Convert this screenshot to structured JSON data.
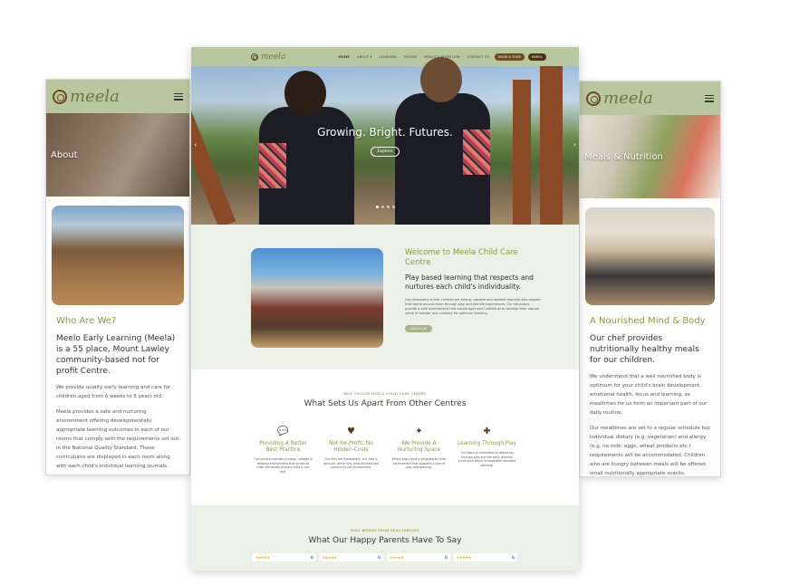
{
  "colors": {
    "header": "#b9c7a0",
    "accent_green": "#8a9a45",
    "brown": "#6b4a1e",
    "section_bg": "#edf0e6"
  },
  "brand": {
    "name": "meela"
  },
  "left_mobile": {
    "hero_title": "About",
    "heading": "Who Are We?",
    "lead": "Meelo Early Learning (Meela) is a 55 place, Mount Lawley community-based not for profit Centre.",
    "para1": "We provide quality early learning and care for children aged from 6 weeks to 5 years old.",
    "para2": "Meela provides a safe and nurturing environment offering developmentally appropriate learning outcomes in each of our rooms that comply with the requirements set out in the National Quality Standard. These curriculums are displayed in each room along with each child's individual learning journals."
  },
  "right_mobile": {
    "hero_title": "Meals & Nutrition",
    "heading": "A Nourished Mind & Body",
    "lead": "Our chef provides nutritionally healthy meals for our children.",
    "para1": "We understand that a well nourished body is optimum for your child's brain development, emotional health, focus and learning, so mealtimes for us form an important part of our daily routine.",
    "para2": "Our mealtimes are set to a regular schedule but individual dietary (e.g. vegetarian) and allergy (e.g. no milk, eggs, wheat products etc.) requirements will be accommodated. Children who are hungry between meals will be offered small nutritionally appropriate snacks."
  },
  "desktop": {
    "nav": {
      "items": [
        "HOME",
        "ABOUT ▾",
        "LEARNING",
        "ROOMS",
        "MEALS & NUTRITION",
        "CONTACT US"
      ],
      "tour": "BOOK A TOUR",
      "enrol": "ENROL"
    },
    "hero": {
      "title": "Growing. Bright. Futures.",
      "button": "Explore"
    },
    "welcome": {
      "title": "Welcome to Meela Child Care Centre",
      "lead": "Play based learning that respects and nurtures each child's individuality.",
      "body": "Our philosophy is that children are strong, capable and resilient learners who explore their world around them through play and real life experiences. Our educators provide a safe environment that encourages each individual to develop their natural sense of wonder and curiosity for optimum learning.",
      "button": "ABOUT US"
    },
    "why": {
      "eyebrow": "WHY CHOOSE MEELA CHILD CARE CENTRE",
      "title": "What Sets Us Apart From Other Centres",
      "features": [
        {
          "icon": "chat-bubbles-icon",
          "glyph": "💬",
          "title": "Providing A Better Best Practice",
          "text": "Our service provides a happy, cottage & relaxing environment that strives to meet the needs of every child in our care."
        },
        {
          "icon": "heart-hand-icon",
          "glyph": "♥",
          "title": "Not-for-Profit, No Hidden-Costs",
          "text": "Our fees are transparent, our care is genuine, we're fully child-focused and community-led environment."
        },
        {
          "icon": "child-icon",
          "glyph": "✦",
          "title": "We Provide A Nurturing Space",
          "text": "Where each child is empowered in an environment that supports a love of play and learning."
        },
        {
          "icon": "puzzle-icon",
          "glyph": "✚",
          "title": "Learning Through Play",
          "text": "Our team is committed to delivering through play and the early learning curriculum which incorporates standard learning."
        }
      ]
    },
    "reviews": {
      "eyebrow": "REAL WORDS FROM REAL FAMILIES",
      "title": "What Our Happy Parents Have To Say",
      "stars": "★★★★★",
      "google": "G"
    }
  }
}
